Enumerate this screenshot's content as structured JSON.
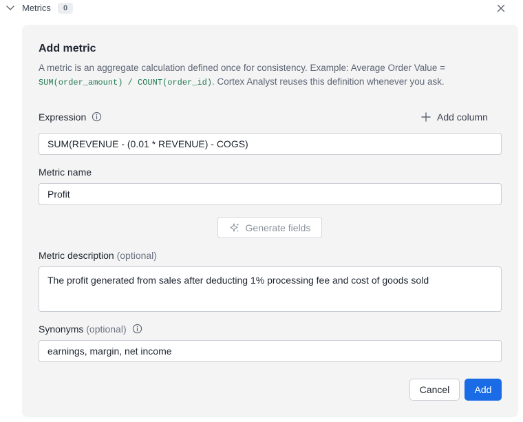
{
  "section": {
    "title": "Metrics",
    "count": "0"
  },
  "dialog": {
    "title": "Add metric",
    "description": {
      "part1": "A metric is an aggregate calculation defined once for consistency. Example: Average Order Value = ",
      "code": "SUM(order_amount) / COUNT(order_id)",
      "part2": ". Cortex Analyst reuses this definition whenever you ask."
    },
    "expression": {
      "label": "Expression",
      "add_column_label": "Add column",
      "value": "SUM(REVENUE - (0.01 * REVENUE) - COGS)"
    },
    "metric_name": {
      "label": "Metric name",
      "value": "Profit"
    },
    "generate_label": "Generate fields",
    "metric_description": {
      "label": "Metric description",
      "optional": "(optional)",
      "value": "The profit generated from sales after deducting 1% processing fee and cost of goods sold"
    },
    "synonyms": {
      "label": "Synonyms",
      "optional": "(optional)",
      "value": "earnings, margin, net income"
    },
    "cancel_label": "Cancel",
    "add_label": "Add"
  },
  "colors": {
    "primary": "#1a6ce6",
    "panel_bg": "#f4f4f5",
    "code": "#1e7a4f"
  },
  "icons": [
    "chevron-down-icon",
    "close-icon",
    "info-icon",
    "plus-icon",
    "sparkle-icon"
  ]
}
